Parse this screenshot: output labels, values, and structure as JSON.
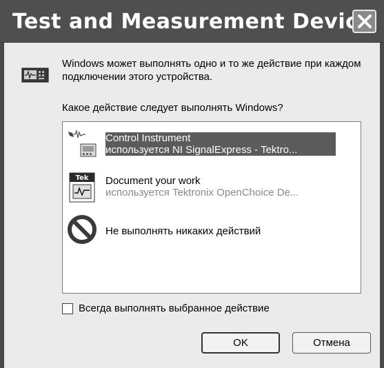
{
  "window": {
    "title": "Test and Measurement Device"
  },
  "dialog": {
    "intro_text": "Windows может выполнять одно и то же действие при каждом подключении этого устройства.",
    "question": "Какое действие следует выполнять Windows?",
    "actions": [
      {
        "title": "Control Instrument",
        "subtitle": "используется NI SignalExpress - Tektro...",
        "icon": "control-instrument-icon",
        "selected": true
      },
      {
        "title": "Document your work",
        "subtitle": "используется Tektronix OpenChoice De...",
        "icon": "tek-document-icon",
        "selected": false
      },
      {
        "title": "Не выполнять никаких действий",
        "subtitle": "",
        "icon": "no-action-icon",
        "selected": false
      }
    ],
    "always_checkbox_label": "Всегда выполнять выбранное действие",
    "ok_label": "OK",
    "cancel_label": "Отмена"
  },
  "colors": {
    "titlebar": "#4f4f4f",
    "selection": "#5b5b5b",
    "dialog_bg": "#ebebeb"
  }
}
